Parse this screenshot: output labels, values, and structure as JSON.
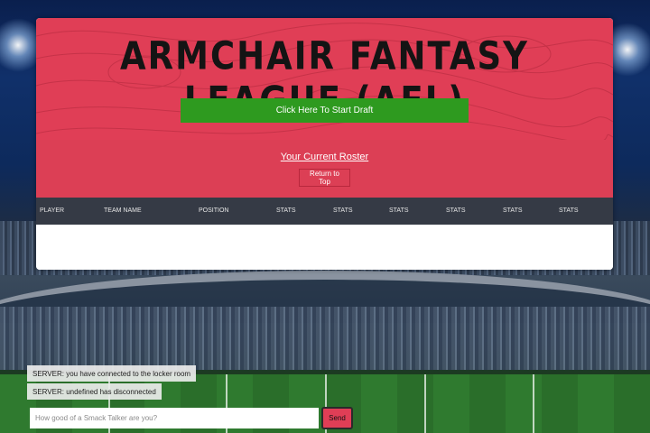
{
  "header": {
    "title": "ARMCHAIR FANTASY LEAGUE (AFL)",
    "draft_button": "Click Here To Start Draft"
  },
  "roster": {
    "link": "Your Current Roster",
    "return_button": "Return to Top"
  },
  "table": {
    "columns": [
      "PLAYER",
      "TEAM NAME",
      "POSITION",
      "STATS",
      "STATS",
      "STATS",
      "STATS",
      "STATS",
      "STATS"
    ],
    "rows": []
  },
  "chat": {
    "messages": [
      "SERVER: you have connected to the locker room",
      "SERVER: undefined has disconnected"
    ],
    "input_placeholder": "How good of a Smack Talker are you?",
    "send_label": "Send"
  },
  "colors": {
    "hero": "#e03e56",
    "draft_button": "#2e9a1f",
    "table_header": "#353a45"
  }
}
